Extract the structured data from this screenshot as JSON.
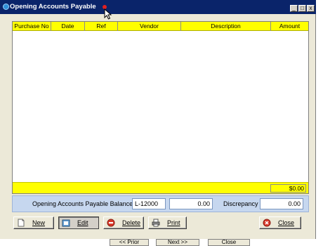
{
  "window": {
    "title": "Opening Accounts Payable",
    "controls": {
      "minimize": "_",
      "maximize": "□",
      "close": "x"
    }
  },
  "grid": {
    "columns": [
      "Purchase No",
      "Date",
      "Ref",
      "Vendor",
      "Description",
      "Amount"
    ],
    "rows": [],
    "total": "$0.00"
  },
  "balance": {
    "label": "Opening Accounts Payable Balance",
    "account": "L-12000",
    "amount": "0.00",
    "discrepancy_label": "Discrepancy",
    "discrepancy": "0.00"
  },
  "buttons": {
    "new": "New",
    "edit": "Edit",
    "delete": "Delete",
    "print": "Print",
    "close": "Close"
  },
  "background_buttons": {
    "prior": "<< Prior",
    "next": "Next >>",
    "close": "Close"
  }
}
